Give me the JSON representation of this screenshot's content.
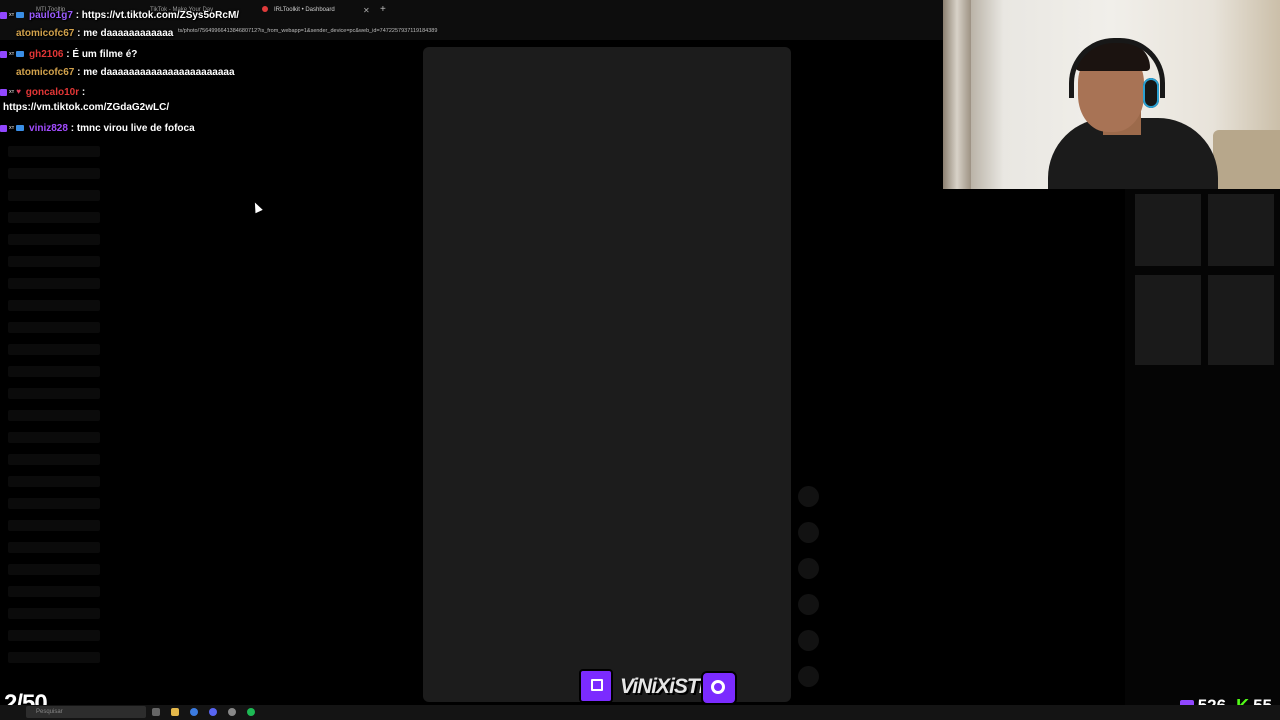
{
  "browser": {
    "tabs": [
      {
        "label": "MTI Tooltip",
        "active": false
      },
      {
        "label": "TikTok - Make Your Day",
        "active": false
      },
      {
        "label": "IRLToolkit • Dashboard",
        "active": true
      }
    ],
    "url": "ts/photo/7564996641384680712?is_from_webapp=1&sender_device=pc&web_id=7472257937119184389"
  },
  "chat": {
    "messages": [
      {
        "user": "paulo1g7",
        "text": " : https://vt.tiktok.com/ZSys5oRcM/",
        "color": "#9b5cff",
        "badges": [
          "twitch",
          "xt",
          "blue"
        ]
      },
      {
        "user": "atomicofc67",
        "text": " : me daaaaaaaaaaaa",
        "color": "#d2a24c",
        "badges": []
      },
      {
        "user": "gh2106",
        "text": " : É um filme é?",
        "color": "#e33636",
        "badges": [
          "twitch",
          "xt",
          "blue"
        ]
      },
      {
        "user": "atomicofc67",
        "text": " : me daaaaaaaaaaaaaaaaaaaaaaa",
        "color": "#d2a24c",
        "badges": []
      },
      {
        "user": "goncalo10r",
        "text": " :",
        "color": "#e33636",
        "badges": [
          "twitch",
          "xt",
          "heart"
        ]
      },
      {
        "user": "",
        "text": "https://vm.tiktok.com/ZGdaG2wLC/",
        "color": "#ffffff",
        "badges": []
      },
      {
        "user": "viniz828",
        "text": " : tmnc virou live de fofoca",
        "color": "#a24cff",
        "badges": [
          "twitch",
          "xt",
          "blue"
        ]
      }
    ]
  },
  "overlay": {
    "goal": "2/50",
    "brand_name": "ViNiXiSTE",
    "twitch_viewers": "526",
    "kick_viewers": "55",
    "kick_glyph": "K"
  },
  "taskbar": {
    "search_placeholder": "Pesquisar"
  },
  "colors": {
    "twitch": "#9147ff",
    "kick": "#53fc18",
    "feed_panel": "#1c1c1c"
  }
}
